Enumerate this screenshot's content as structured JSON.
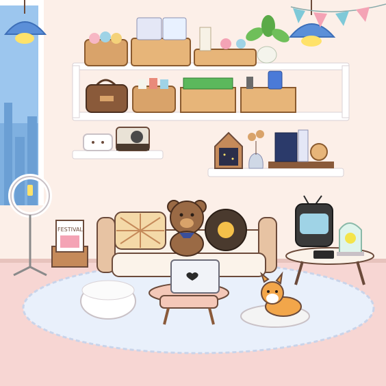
{
  "scene": {
    "name": "cozy-living-room",
    "colors": {
      "wall": "#fcefe8",
      "floor": "#f7d6d3",
      "rug": "#e9f0fb",
      "shelf": "#ffffff",
      "shelf_shadow": "#d9d2d6",
      "wood": "#d9a36a",
      "sofa": "#fbf3ea",
      "lamp_blue": "#5b8fd8",
      "bulb": "#ffe26a",
      "outline": "#6b4a3a"
    }
  },
  "magazine": {
    "title": "FESTIVAL"
  },
  "icons": {
    "ceiling_lamp_left": "ceiling-lamp-icon",
    "ceiling_lamp_right": "ceiling-lamp-icon",
    "ring_light": "ring-light-icon",
    "teddy_bear": "teddy-bear-icon",
    "corgi": "corgi-dog-icon",
    "laptop": "laptop-icon",
    "retro_tv": "retro-tv-icon"
  }
}
